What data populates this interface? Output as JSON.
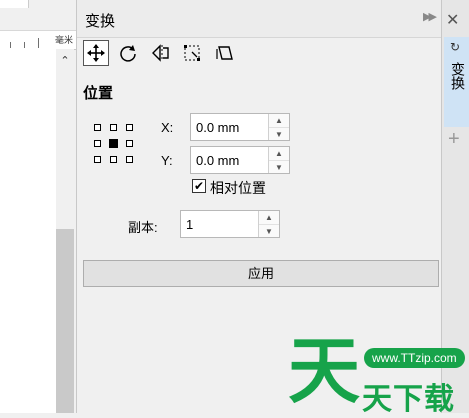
{
  "ruler": {
    "unit": "毫米"
  },
  "docker": {
    "title": "变换",
    "section_title": "位置",
    "x_label": "X:",
    "y_label": "Y:",
    "x_value": "0.0 mm",
    "y_value": "0.0 mm",
    "relative_label": "相对位置",
    "relative_checked": true,
    "copies_label": "副本:",
    "copies_value": "1",
    "apply_label": "应用"
  },
  "toolbar": {
    "buttons": [
      "position-icon",
      "rotate-icon",
      "scale-mirror-icon",
      "size-icon",
      "skew-icon"
    ]
  },
  "tabstrip": {
    "tab_label": "变换"
  },
  "watermark": {
    "brand_big": "天",
    "url": "www.TTzip.com",
    "brand_text": "天下载"
  },
  "colors": {
    "accent_tab": "#cfe3f5",
    "watermark_green": "#16a34a"
  }
}
